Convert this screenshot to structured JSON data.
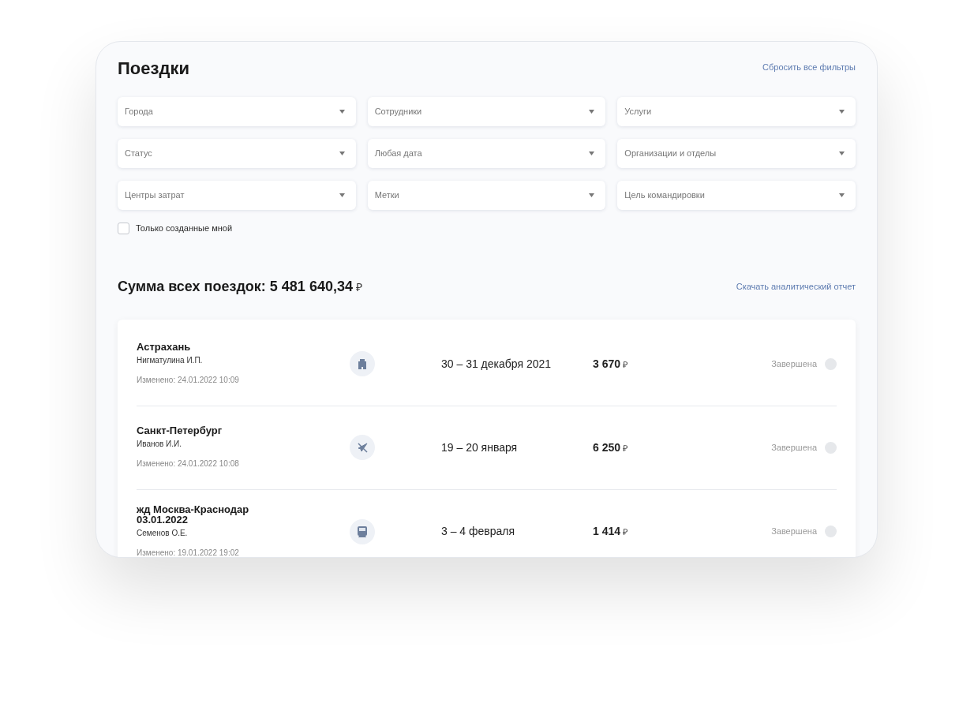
{
  "page": {
    "title": "Поездки",
    "reset_link": "Сбросить все фильтры"
  },
  "filters": [
    {
      "placeholder": "Города"
    },
    {
      "placeholder": "Сотрудники"
    },
    {
      "placeholder": "Услуги"
    },
    {
      "placeholder": "Статус"
    },
    {
      "placeholder": "Любая дата"
    },
    {
      "placeholder": "Организации и отделы"
    },
    {
      "placeholder": "Центры затрат"
    },
    {
      "placeholder": "Метки"
    },
    {
      "placeholder": "Цель командировки"
    }
  ],
  "only_mine": {
    "label": "Только созданные мной",
    "checked": false
  },
  "summary": {
    "label": "Сумма всех поездок: 5 481 640,34",
    "currency": "₽",
    "report_link": "Скачать аналитический отчет"
  },
  "trips": [
    {
      "title": "Астрахань",
      "traveler": "Нигматулина И.П.",
      "modified": "Изменено: 24.01.2022 10:09",
      "kind": "hotel",
      "dates": "30 – 31 декабря 2021",
      "amount": "3 670",
      "currency": "₽",
      "status": "Завершена",
      "color": "#e6e8eb"
    },
    {
      "title": "Санкт-Петербург",
      "traveler": "Иванов И.И.",
      "modified": "Изменено: 24.01.2022 10:08",
      "kind": "flight",
      "dates": "19 – 20 января",
      "amount": "6 250",
      "currency": "₽",
      "status": "Завершена",
      "color": "#e6e8eb"
    },
    {
      "title": "жд Москва-Краснодар 03.01.2022",
      "traveler": "Семенов О.Е.",
      "modified": "Изменено: 19.01.2022 19:02",
      "kind": "train",
      "dates": "3 – 4 февраля",
      "amount": "1 414",
      "currency": "₽",
      "status": "Завершена",
      "color": "#e6e8eb"
    }
  ]
}
